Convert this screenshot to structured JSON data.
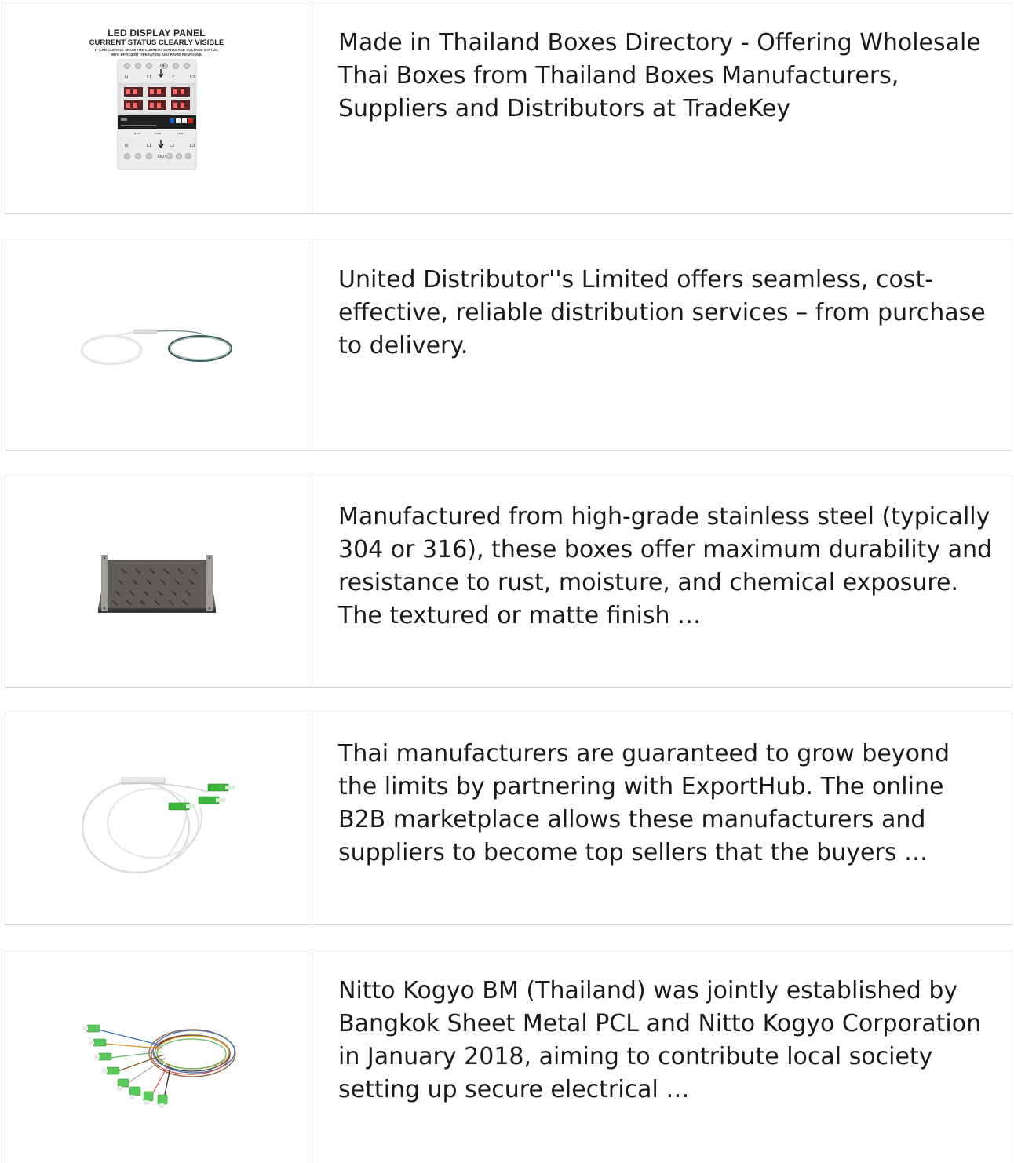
{
  "items": [
    {
      "image": "led-display-panel-voltage-protector",
      "image_text": {
        "title": "LED DISPLAY PANEL",
        "subtitle": "CURRENT STATUS CLEARLY VISIBLE",
        "caption_line1": "IT CAN CLEARLY SHOW THE CURRENT STATUS AND VOLTAGE STATUS.",
        "caption_line2": "WITH EFFICIENT OPERATION AND RAPID RESPONSE.",
        "top_labels": [
          "N",
          "L1",
          "IN",
          "L2",
          "L3"
        ],
        "bottom_labels": [
          "N",
          "L1",
          "OUT",
          "L2",
          "L3"
        ]
      },
      "text": "Made in Thailand Boxes Directory - Offering Wholesale Thai Boxes from Thailand Boxes Manufacturers, Suppliers and Distributors at TradeKey"
    },
    {
      "image": "fiber-optic-plc-splitter-bare",
      "text": "United Distributor''s Limited offers seamless, cost-effective, reliable distribution services – from purchase to delivery."
    },
    {
      "image": "rack-mount-shelf",
      "text": "Manufactured from high-grade stainless steel (typically 304 or 316), these boxes offer maximum durability and resistance to rust, moisture, and chemical exposure. The textured or matte finish …"
    },
    {
      "image": "fiber-optic-plc-splitter-sc-connectors",
      "text": "Thai manufacturers are guaranteed to grow beyond the limits by partnering with ExportHub. The online B2B marketplace allows these manufacturers and suppliers to become top sellers that the buyers …"
    },
    {
      "image": "fiber-optic-pigtail-bundle",
      "text": "Nitto Kogyo BM (Thailand) was jointly established by Bangkok Sheet Metal PCL and Nitto Kogyo Corporation in January 2018, aiming to contribute local society setting up secure electrical …"
    }
  ]
}
